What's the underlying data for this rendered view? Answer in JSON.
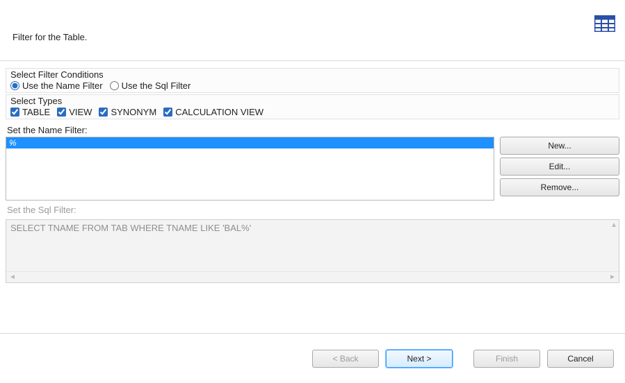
{
  "header": {
    "title": "Filter for the Table.",
    "icon_name": "table-icon"
  },
  "filter_conditions": {
    "group_label": "Select Filter Conditions",
    "use_name_label": "Use the Name Filter",
    "use_sql_label": "Use the Sql Filter",
    "selected": "name"
  },
  "types": {
    "group_label": "Select Types",
    "items": [
      {
        "label": "TABLE",
        "checked": true
      },
      {
        "label": "VIEW",
        "checked": true
      },
      {
        "label": "SYNONYM",
        "checked": true
      },
      {
        "label": "CALCULATION VIEW",
        "checked": true
      }
    ]
  },
  "name_filter": {
    "label": "Set the Name Filter:",
    "entries": [
      "%"
    ],
    "buttons": {
      "new": "New...",
      "edit": "Edit...",
      "remove": "Remove..."
    }
  },
  "sql_filter": {
    "label": "Set the Sql Filter:",
    "text": "SELECT TNAME FROM TAB WHERE TNAME LIKE 'BAL%'",
    "enabled": false
  },
  "wizard": {
    "back": "< Back",
    "next": "Next >",
    "finish": "Finish",
    "cancel": "Cancel",
    "back_enabled": false,
    "finish_enabled": false
  }
}
